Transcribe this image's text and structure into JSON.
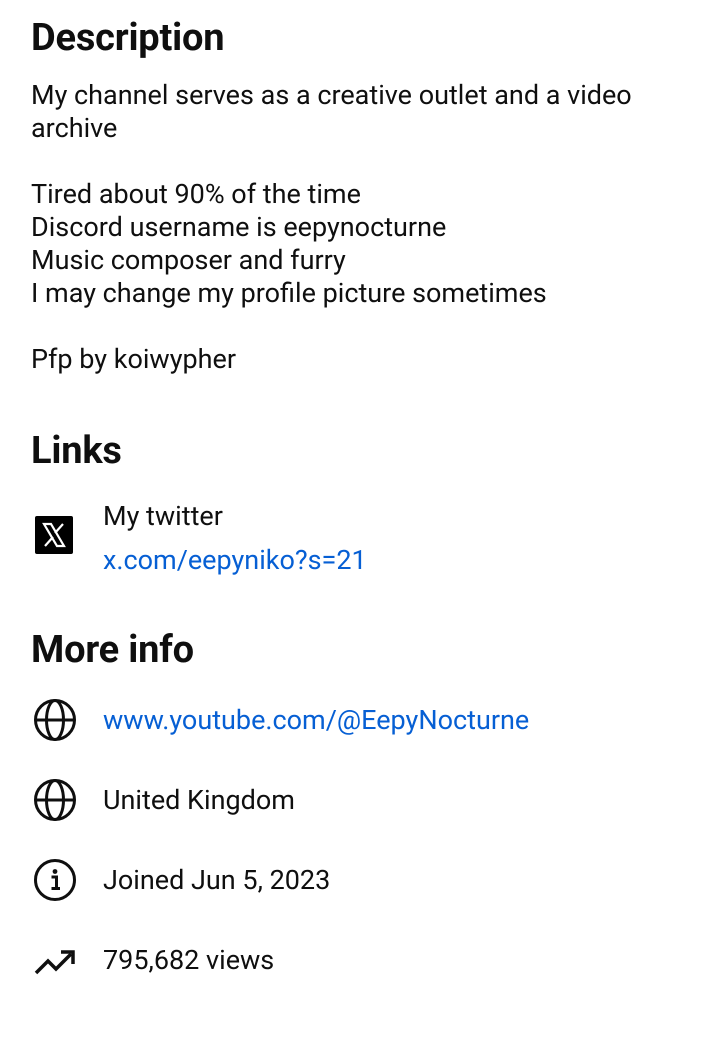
{
  "description": {
    "title": "Description",
    "lines": [
      "My channel serves as a creative outlet and a video archive",
      "",
      "Tired about 90% of the time",
      "Discord username is eepynocturne",
      "Music composer and furry",
      "I may change my profile picture sometimes",
      "",
      "Pfp by koiwypher"
    ]
  },
  "links": {
    "title": "Links",
    "items": [
      {
        "icon": "x-logo-icon",
        "label": "My twitter",
        "url": "x.com/eepyniko?s=21"
      }
    ]
  },
  "more_info": {
    "title": "More info",
    "website": {
      "icon": "globe-icon",
      "text": "www.youtube.com/@EepyNocturne"
    },
    "location": {
      "icon": "globe-icon",
      "text": "United Kingdom"
    },
    "joined": {
      "icon": "info-icon",
      "text": "Joined Jun 5, 2023"
    },
    "views": {
      "icon": "trending-up-icon",
      "text": "795,682 views"
    }
  },
  "colors": {
    "text": "#0f0f0f",
    "link": "#065fd4",
    "background": "#ffffff"
  }
}
